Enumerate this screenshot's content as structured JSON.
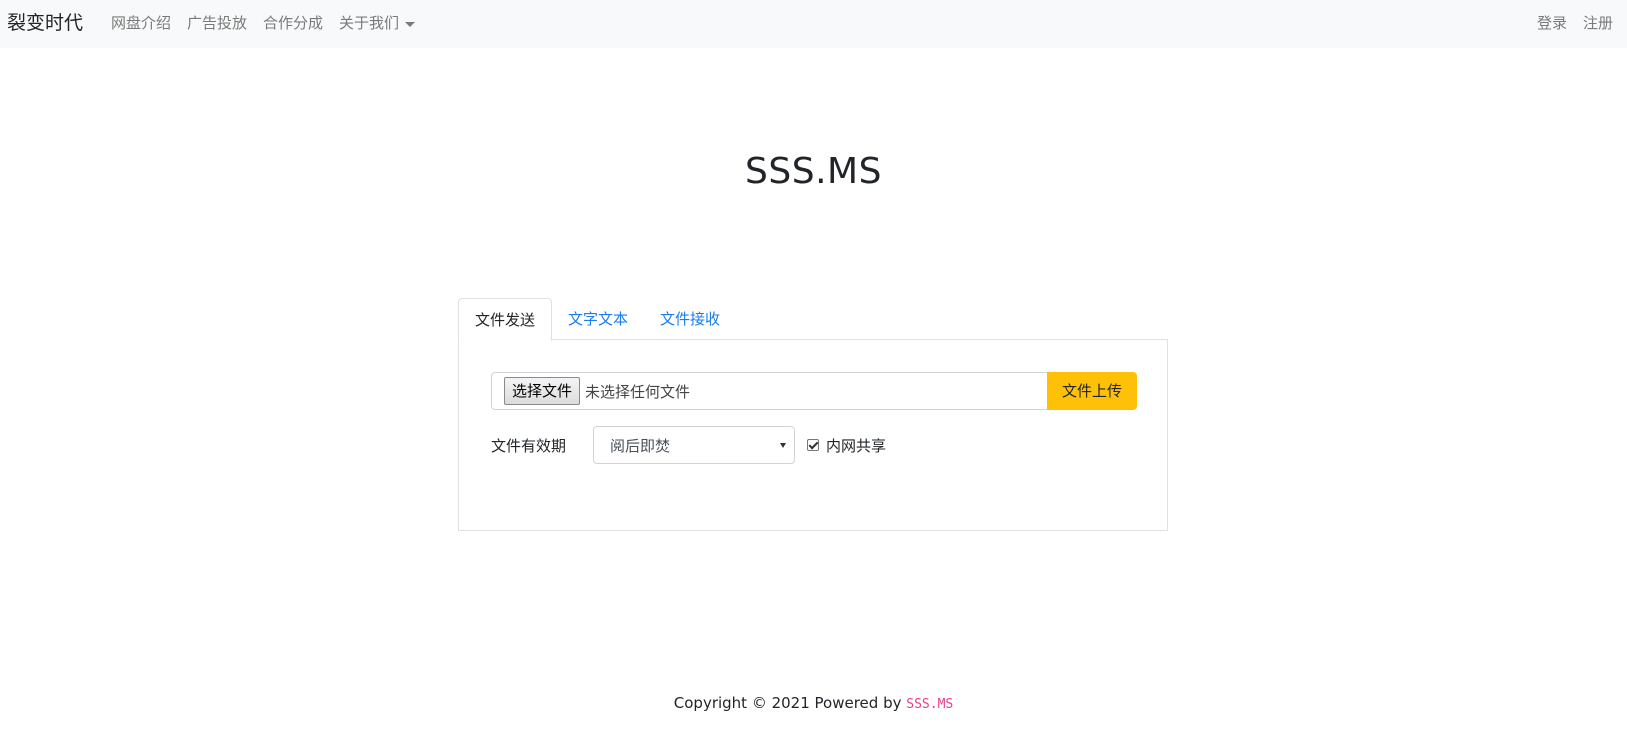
{
  "navbar": {
    "brand": "裂变时代",
    "links": [
      "网盘介绍",
      "广告投放",
      "合作分成"
    ],
    "dropdown": "关于我们",
    "login": "登录",
    "register": "注册"
  },
  "site_title": "SSS.MS",
  "tabs": [
    {
      "label": "文件发送",
      "active": true
    },
    {
      "label": "文字文本",
      "active": false
    },
    {
      "label": "文件接收",
      "active": false
    }
  ],
  "upload": {
    "choose_button": "选择文件",
    "no_file_text": "未选择任何文件",
    "upload_button": "文件上传"
  },
  "expire": {
    "label": "文件有效期",
    "selected": "阅后即焚"
  },
  "intranet": {
    "label": "内网共享",
    "checked": true
  },
  "footer": {
    "text": "Copyright © 2021 Powered by",
    "brand": "SSS.MS"
  },
  "colors": {
    "navbar_bg": "#f8f9fa",
    "link": "#1a7cf0",
    "upload_button": "#ffc107",
    "footer_code": "#e83e8c"
  }
}
